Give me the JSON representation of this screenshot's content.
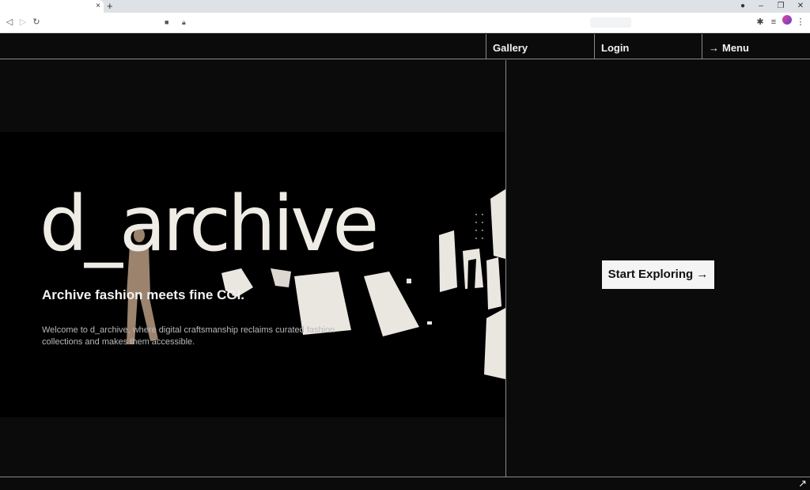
{
  "browser": {
    "tab_close": "×",
    "new_tab": "+",
    "window_controls": [
      "–",
      "❐",
      "✕"
    ],
    "nav_icons": [
      "back-icon",
      "forward-icon",
      "reload-icon"
    ]
  },
  "nav": {
    "gallery": "Gallery",
    "login": "Login",
    "menu": "Menu",
    "menu_icon": "→"
  },
  "hero": {
    "title": "d_archive",
    "subtitle": "Archive fashion meets fine CGI.",
    "description": "Welcome to d_archive, where digital craftsmanship reclaims curated fashion collections and makes them accessible."
  },
  "cta": {
    "label": "Start Exploring",
    "icon": "→"
  },
  "corner": {
    "icon": "↗"
  },
  "colors": {
    "background": "#0b0b0b",
    "hero_bg": "#000000",
    "text": "#efece6",
    "divider": "#8a8a8a",
    "button_bg": "#f4f4f4"
  }
}
